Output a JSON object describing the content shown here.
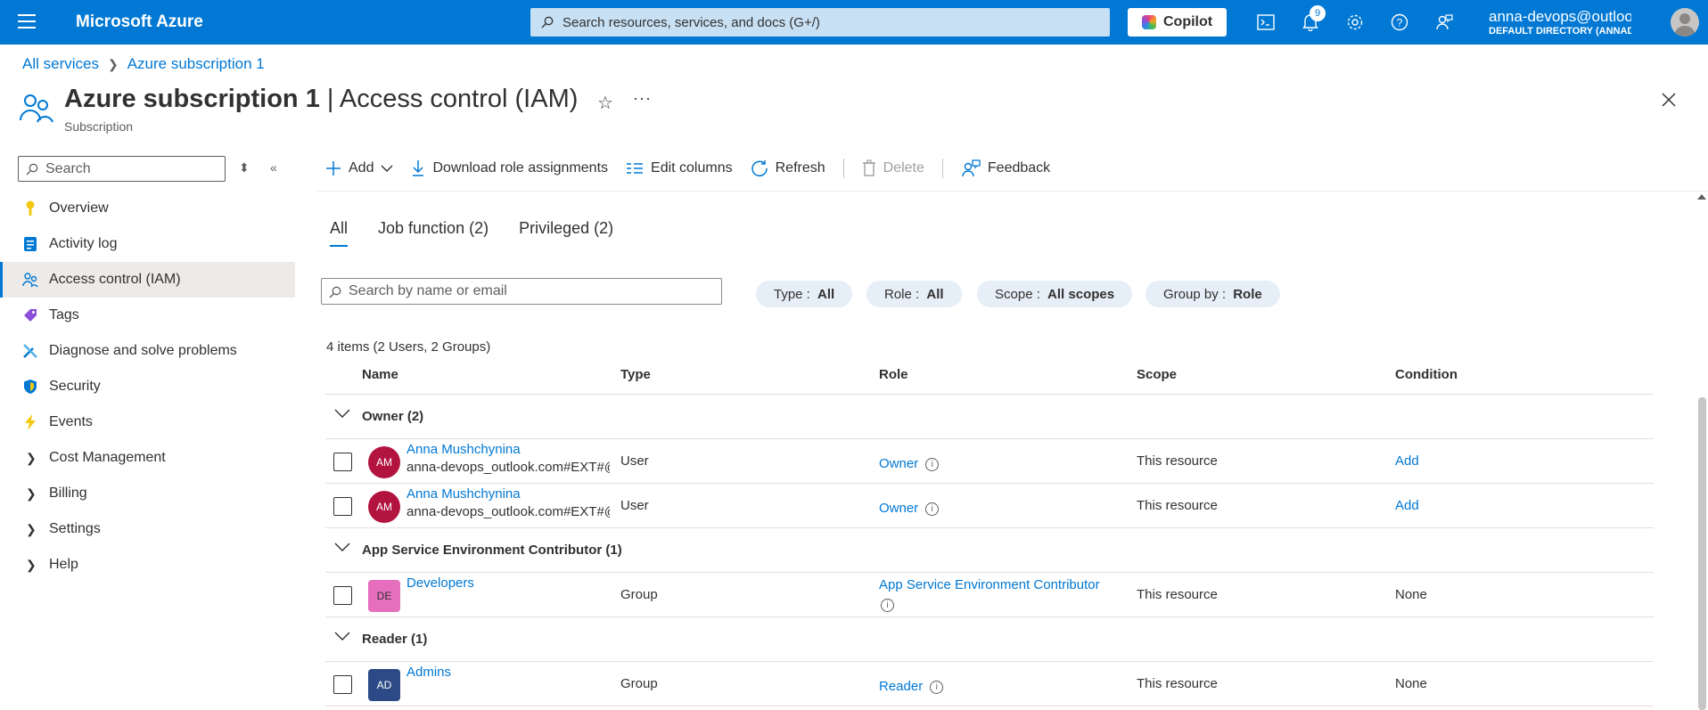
{
  "topbar": {
    "brand": "Microsoft Azure",
    "search_placeholder": "Search resources, services, and docs (G+/)",
    "copilot_label": "Copilot",
    "notification_count": "9",
    "account_name": "anna-devops@outlook....",
    "account_directory": "DEFAULT DIRECTORY (ANNADEV..."
  },
  "breadcrumb": [
    "All services",
    "Azure subscription 1"
  ],
  "page": {
    "title_main": "Azure subscription 1",
    "title_sep": " | ",
    "title_section": "Access control (IAM)",
    "subtitle": "Subscription"
  },
  "sidebar": {
    "search_placeholder": "Search",
    "items": [
      {
        "label": "Overview",
        "icon": "key-icon"
      },
      {
        "label": "Activity log",
        "icon": "log-icon"
      },
      {
        "label": "Access control (IAM)",
        "icon": "people-icon",
        "active": true
      },
      {
        "label": "Tags",
        "icon": "tag-icon"
      },
      {
        "label": "Diagnose and solve problems",
        "icon": "wrench-icon"
      },
      {
        "label": "Security",
        "icon": "shield-icon"
      },
      {
        "label": "Events",
        "icon": "lightning-icon"
      },
      {
        "label": "Cost Management",
        "expandable": true
      },
      {
        "label": "Billing",
        "expandable": true
      },
      {
        "label": "Settings",
        "expandable": true
      },
      {
        "label": "Help",
        "expandable": true
      }
    ]
  },
  "toolbar": {
    "add": "Add",
    "download": "Download role assignments",
    "edit_columns": "Edit columns",
    "refresh": "Refresh",
    "delete": "Delete",
    "feedback": "Feedback"
  },
  "tabs": [
    "All",
    "Job function (2)",
    "Privileged (2)"
  ],
  "filters": {
    "search_placeholder": "Search by name or email",
    "type_label": "Type : ",
    "type_value": "All",
    "role_label": "Role : ",
    "role_value": "All",
    "scope_label": "Scope : ",
    "scope_value": "All scopes",
    "groupby_label": "Group by : ",
    "groupby_value": "Role"
  },
  "items_count": "4 items (2 Users, 2 Groups)",
  "table": {
    "columns": [
      "Name",
      "Type",
      "Role",
      "Scope",
      "Condition"
    ],
    "groups": [
      {
        "label": "Owner (2)",
        "rows": [
          {
            "initials": "AM",
            "name": "Anna Mushchynina",
            "email": "anna-devops_outlook.com#EXT#@annadevopsoutlook.onmicrosoft.com",
            "type": "User",
            "role": "Owner",
            "scope": "This resource",
            "condition": "Add"
          },
          {
            "initials": "AM",
            "name": "Anna Mushchynina",
            "email": "anna-devops_outlook.com#EXT#@annadevopsoutlook.onmicrosoft.com",
            "type": "User",
            "role": "Owner",
            "scope": "This resource",
            "condition": "Add"
          }
        ]
      },
      {
        "label": "App Service Environment Contributor (1)",
        "rows": [
          {
            "initials": "DE",
            "name": "Developers",
            "email": "",
            "type": "Group",
            "role": "App Service Environment Contributor",
            "scope": "This resource",
            "condition": "None"
          }
        ]
      },
      {
        "label": "Reader (1)",
        "rows": [
          {
            "initials": "AD",
            "name": "Admins",
            "email": "",
            "type": "Group",
            "role": "Reader",
            "scope": "This resource",
            "condition": "None"
          }
        ]
      }
    ]
  }
}
